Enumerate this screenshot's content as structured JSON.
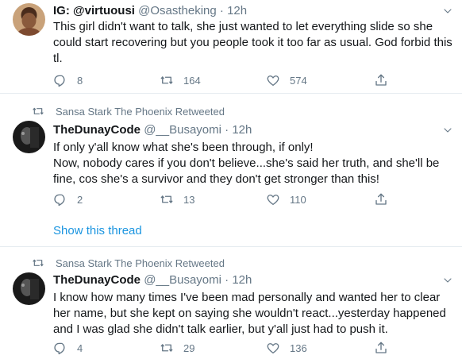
{
  "tweets": [
    {
      "name": "IG: @virtuousi",
      "handle": "@Osastheking",
      "time": "12h",
      "text": [
        "This girl didn't want to talk, she just wanted to let everything slide so she",
        "could start recovering but you people took it too far as usual. God forbid this",
        "tl."
      ],
      "replies": "8",
      "retweets": "164",
      "likes": "574"
    },
    {
      "retweeted_by": "Sansa Stark The Phoenix Retweeted",
      "name": "TheDunayCode",
      "handle": "@__Busayomi",
      "time": "12h",
      "text": [
        "If only y'all know what she's been through, if only!",
        "Now, nobody cares if you don't believe...she's said her truth, and she'll be",
        "fine, cos she's a survivor and they don't get stronger than this!"
      ],
      "replies": "2",
      "retweets": "13",
      "likes": "110",
      "show_thread": "Show this thread"
    },
    {
      "retweeted_by": "Sansa Stark The Phoenix Retweeted",
      "name": "TheDunayCode",
      "handle": "@__Busayomi",
      "time": "12h",
      "text": [
        "I know how many times I've been mad personally and wanted her to clear",
        "her name, but she kept on saying she wouldn't react...yesterday happened",
        "and I was glad she didn't talk earlier, but y'all just had to push it."
      ],
      "replies": "4",
      "retweets": "29",
      "likes": "136"
    }
  ],
  "separator": "·"
}
